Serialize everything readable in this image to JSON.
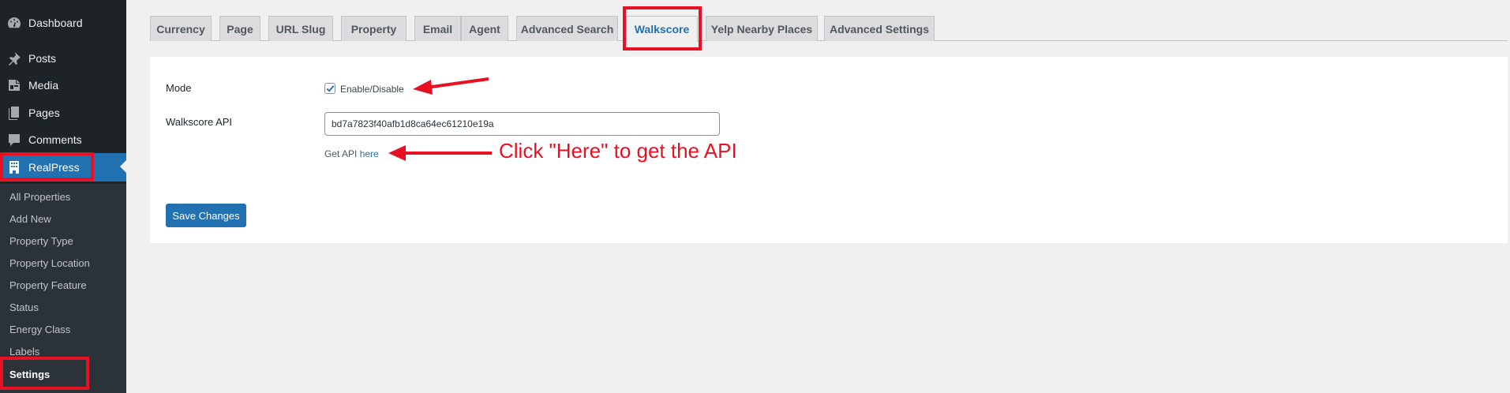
{
  "sidebar": {
    "menu": [
      {
        "label": "Dashboard",
        "icon": "dashboard-icon"
      },
      {
        "label": "Posts",
        "icon": "pin-icon"
      },
      {
        "label": "Media",
        "icon": "media-icon"
      },
      {
        "label": "Pages",
        "icon": "pages-icon"
      },
      {
        "label": "Comments",
        "icon": "comments-icon"
      },
      {
        "label": "RealPress",
        "icon": "building-icon"
      }
    ],
    "submenu": [
      "All Properties",
      "Add New",
      "Property Type",
      "Property Location",
      "Property Feature",
      "Status",
      "Energy Class",
      "Labels",
      "Settings"
    ],
    "current_submenu": "Settings"
  },
  "tabs": [
    "Currency",
    "Page",
    "URL Slug",
    "Property",
    "Email",
    "Agent",
    "Advanced Search",
    "Walkscore",
    "Yelp Nearby Places",
    "Advanced Settings"
  ],
  "active_tab": "Walkscore",
  "form": {
    "mode_label": "Mode",
    "mode_checkbox_label": "Enable/Disable",
    "mode_checked": true,
    "api_label": "Walkscore API",
    "api_value": "bd7a7823f40afb1d8ca64ec61210e19a",
    "get_api_text": "Get API",
    "get_api_link": "here",
    "save_label": "Save Changes"
  },
  "annotations": {
    "callout_text": "Click \"Here\" to get the API",
    "color": "#e81123"
  },
  "colors": {
    "sidebar_bg": "#1d2327",
    "submenu_bg": "#2c3338",
    "accent": "#2271b1",
    "annotation": "#e81123"
  }
}
